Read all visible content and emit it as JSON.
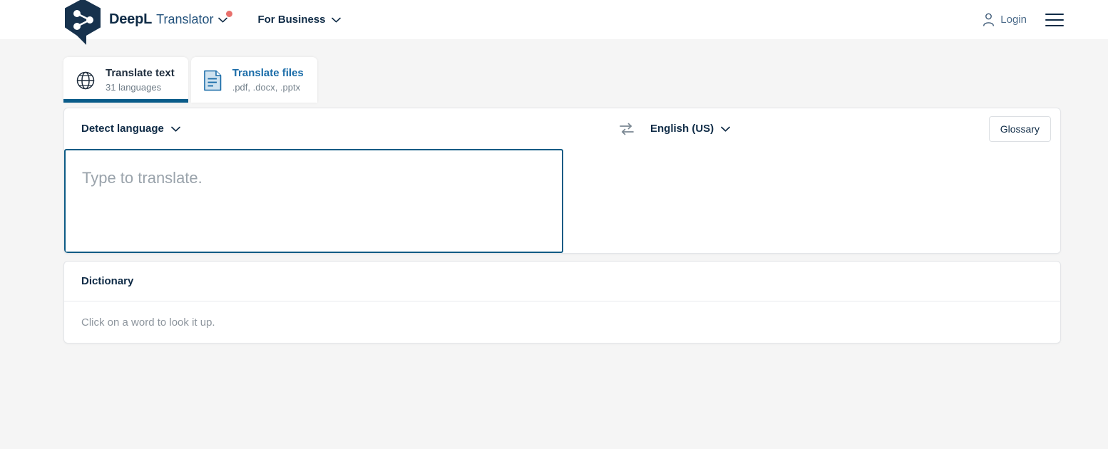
{
  "header": {
    "logo_icon": "deepl-share-hexagon-logo",
    "brand_name": "DeepL",
    "product_name": "Translator",
    "product_chevron_icon": "chevron-down-icon",
    "notification_dot": "notification-dot",
    "business_label": "For Business",
    "business_chevron_icon": "chevron-down-icon",
    "login_icon": "person-icon",
    "login_label": "Login",
    "menu_icon": "hamburger-menu-icon"
  },
  "tabs": [
    {
      "id": "translate-text",
      "icon": "globe-icon",
      "title": "Translate text",
      "subtitle": "31 languages",
      "active": true
    },
    {
      "id": "translate-files",
      "icon": "document-icon",
      "title": "Translate files",
      "subtitle": ".pdf, .docx, .pptx",
      "active": false
    }
  ],
  "translator": {
    "source_language": "Detect language",
    "source_chevron_icon": "chevron-down-icon",
    "swap_icon": "swap-arrows-icon",
    "target_language": "English (US)",
    "target_chevron_icon": "chevron-down-icon",
    "glossary_label": "Glossary",
    "source_placeholder": "Type to translate.",
    "source_value": "",
    "target_value": ""
  },
  "dictionary": {
    "title": "Dictionary",
    "empty_message": "Click on a word to look it up."
  },
  "colors": {
    "brand_navy": "#0f2b46",
    "accent_blue": "#0a5c8a",
    "link_blue": "#1a6ca8",
    "focus_border": "#0d5b85",
    "notification_red": "#e8706c",
    "page_bg": "#f5f5f5"
  }
}
